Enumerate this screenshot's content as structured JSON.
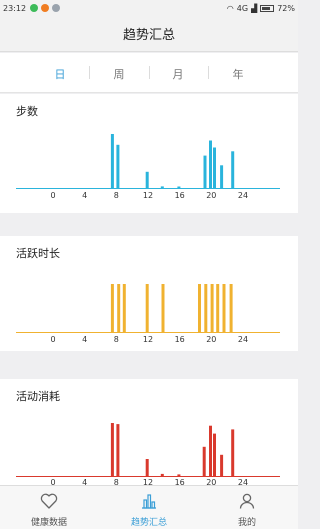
{
  "status_bar": {
    "time": "23:12",
    "network": "4G",
    "battery": "72%"
  },
  "header": {
    "title": "趋势汇总"
  },
  "period_tabs": [
    {
      "label": "日",
      "active": true
    },
    {
      "label": "周",
      "active": false
    },
    {
      "label": "月",
      "active": false
    },
    {
      "label": "年",
      "active": false
    }
  ],
  "chart_data": [
    {
      "type": "bar",
      "title": "步数",
      "color": "#2ab4dc",
      "x_ticks": [
        "0",
        "4",
        "8",
        "12",
        "16",
        "20",
        "24"
      ],
      "xlim": [
        0,
        24
      ],
      "ylim": [
        0,
        1
      ],
      "x": [
        7.5,
        8.2,
        11.9,
        13.8,
        15.9,
        19.2,
        19.9,
        20.4,
        21.3,
        22.7
      ],
      "values": [
        1.0,
        0.8,
        0.3,
        0.03,
        0.02,
        0.6,
        0.88,
        0.75,
        0.42,
        0.68
      ]
    },
    {
      "type": "bar",
      "title": "活跃时长",
      "color": "#f0b230",
      "x_ticks": [
        "0",
        "4",
        "8",
        "12",
        "16",
        "20",
        "24"
      ],
      "xlim": [
        0,
        24
      ],
      "ylim": [
        0,
        1
      ],
      "x": [
        7.5,
        8.3,
        9.0,
        11.9,
        13.9,
        18.5,
        19.3,
        20.1,
        20.8,
        21.6,
        22.5
      ],
      "values": [
        1,
        1,
        1,
        1,
        1,
        1,
        1,
        1,
        1,
        1,
        1
      ]
    },
    {
      "type": "bar",
      "title": "活动消耗",
      "color": "#d9392d",
      "x_ticks": [
        "0",
        "4",
        "8",
        "12",
        "16",
        "20",
        "24"
      ],
      "xlim": [
        0,
        24
      ],
      "ylim": [
        0,
        1
      ],
      "x": [
        7.5,
        8.2,
        11.9,
        13.8,
        15.9,
        19.1,
        19.9,
        20.4,
        21.3,
        22.7
      ],
      "values": [
        1.0,
        0.98,
        0.32,
        0.04,
        0.03,
        0.55,
        0.95,
        0.8,
        0.4,
        0.88
      ]
    }
  ],
  "tab_bar": [
    {
      "label": "健康数据",
      "icon": "heart-icon",
      "active": false
    },
    {
      "label": "趋势汇总",
      "icon": "bar-chart-icon",
      "active": true
    },
    {
      "label": "我的",
      "icon": "person-icon",
      "active": false
    }
  ]
}
